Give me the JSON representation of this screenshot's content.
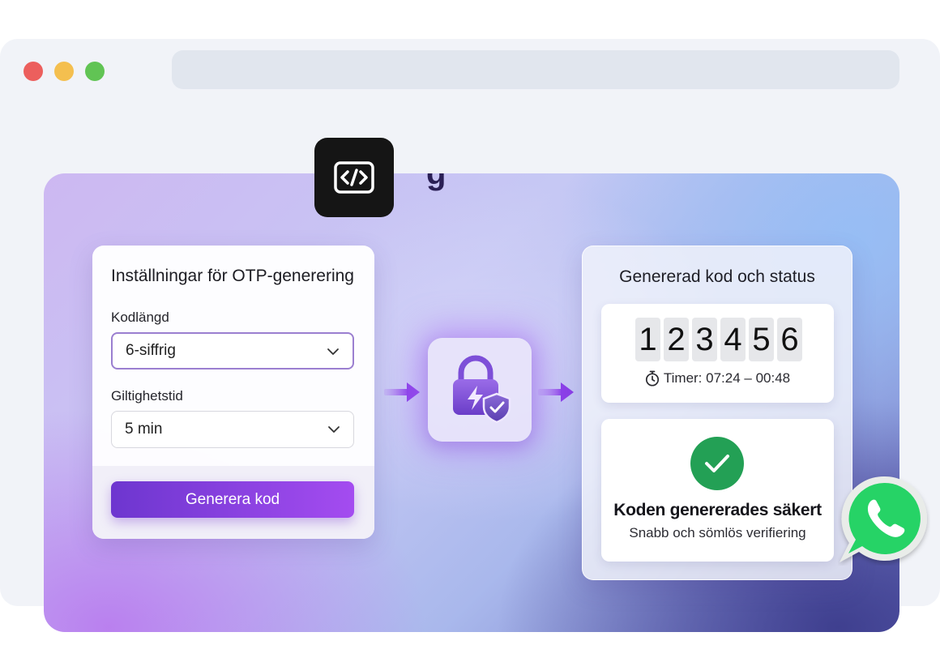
{
  "settings": {
    "title": "Inställningar för OTP-generering",
    "length_label": "Kodlängd",
    "length_value": "6-siffrig",
    "validity_label": "Giltighetstid",
    "validity_value": "5 min",
    "generate_label": "Generera kod"
  },
  "result": {
    "title": "Genererad kod och status",
    "digits": [
      "1",
      "2",
      "3",
      "4",
      "5",
      "6"
    ],
    "timer": "Timer: 07:24 – 00:48",
    "status_title": "Koden genererades säkert",
    "status_subtitle": "Snabb och sömlös verifiering"
  },
  "icons": {
    "code": "code-brackets-icon",
    "lock": "lock-bolt-shield-icon",
    "check": "check-icon",
    "stopwatch": "stopwatch-icon",
    "whatsapp": "whatsapp-icon"
  },
  "colors": {
    "accent": "#7a3fdc",
    "success": "#23a055",
    "whatsapp": "#25d366"
  }
}
